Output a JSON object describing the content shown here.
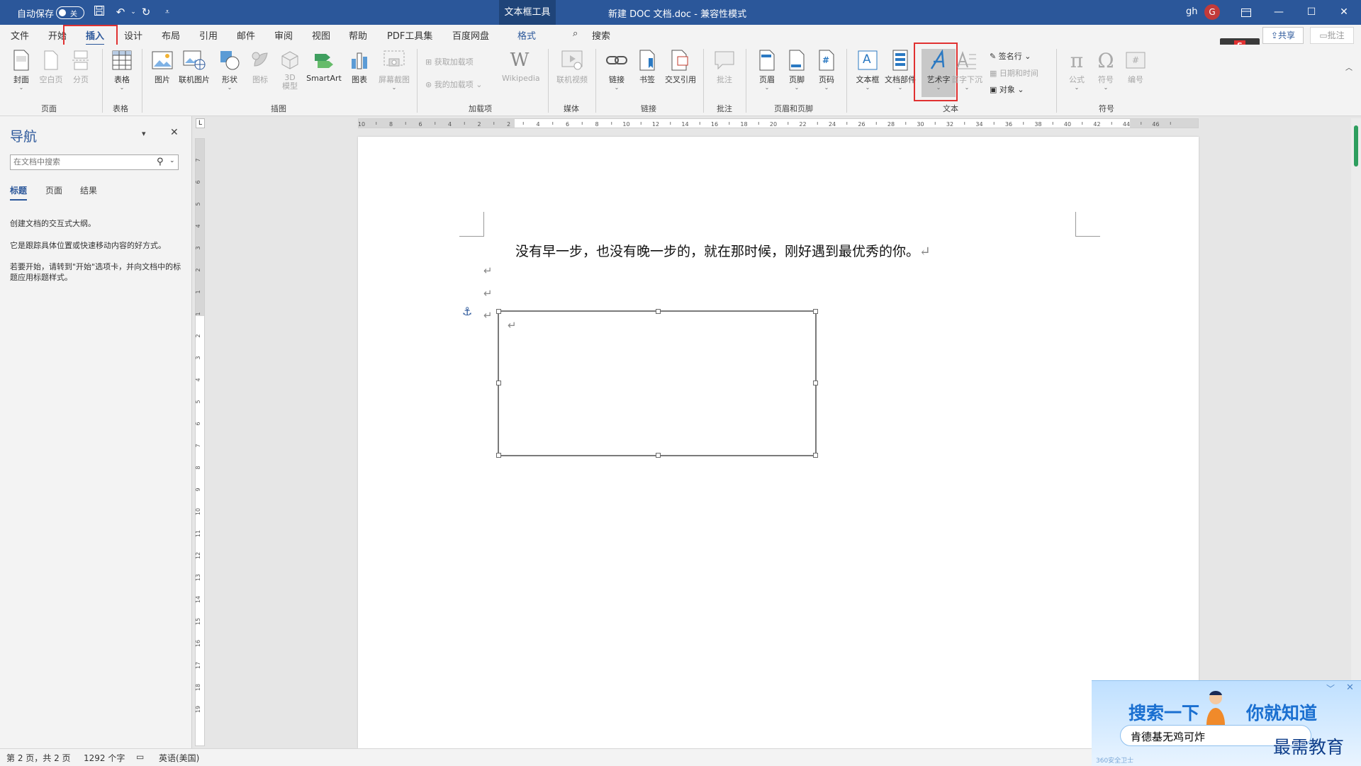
{
  "titlebar": {
    "autosave_label": "自动保存",
    "autosave_state": "关",
    "context_tab": "文本框工具",
    "doc_title": "新建 DOC 文档.doc",
    "separator": "-",
    "mode": "兼容性模式",
    "user": "gh",
    "avatar_initial": "G"
  },
  "tabs": [
    "文件",
    "开始",
    "插入",
    "设计",
    "布局",
    "引用",
    "邮件",
    "审阅",
    "视图",
    "帮助",
    "PDF工具集",
    "百度网盘",
    "格式"
  ],
  "tell_me": "搜索",
  "share_label": "共享",
  "comment_label": "批注",
  "ribbon": {
    "pages": [
      "封面",
      "空白页",
      "分页"
    ],
    "table": "表格",
    "illustrations": [
      "图片",
      "联机图片",
      "形状",
      "图标",
      "3D\n模型",
      "SmartArt",
      "图表",
      "屏幕截图"
    ],
    "addins": [
      "获取加载项",
      "我的加载项",
      "Wikipedia"
    ],
    "media": "联机视频",
    "links": [
      "链接",
      "书签",
      "交叉引用"
    ],
    "comments": "批注",
    "header_footer": [
      "页眉",
      "页脚",
      "页码"
    ],
    "text": [
      "文本框",
      "文档部件",
      "艺术字",
      "首字下沉"
    ],
    "text_small": [
      "签名行",
      "日期和时间",
      "对象"
    ],
    "symbols": [
      "公式",
      "符号",
      "编号"
    ],
    "groups": [
      "页面",
      "表格",
      "插图",
      "加载项",
      "媒体",
      "链接",
      "批注",
      "页眉和页脚",
      "文本",
      "符号"
    ]
  },
  "icons": {
    "wikipedia": "W",
    "equation": "π",
    "symbol": "Ω",
    "page_number": "#",
    "text_box": "A",
    "smartart": "▶"
  },
  "nav": {
    "title": "导航",
    "search_placeholder": "在文档中搜索",
    "tabs": [
      "标题",
      "页面",
      "结果"
    ],
    "paragraphs": [
      "创建文档的交互式大纲。",
      "它是跟踪具体位置或快速移动内容的好方式。",
      "若要开始，请转到\"开始\"选项卡，并向文档中的标题应用标题样式。"
    ]
  },
  "ruler": {
    "h_ticks": [
      "10",
      "8",
      "6",
      "4",
      "2",
      "2",
      "4",
      "6",
      "8",
      "10",
      "12",
      "14",
      "16",
      "18",
      "20",
      "22",
      "24",
      "26",
      "28",
      "30",
      "32",
      "34",
      "36",
      "38",
      "40",
      "42",
      "44",
      "46"
    ],
    "v_ticks": [
      "7",
      "6",
      "5",
      "4",
      "3",
      "2",
      "1",
      "1",
      "2",
      "3",
      "4",
      "5",
      "6",
      "7",
      "8",
      "9",
      "10",
      "11",
      "12",
      "13",
      "14",
      "15",
      "16",
      "17",
      "18",
      "19"
    ],
    "corner": "L"
  },
  "document": {
    "line1": "没有早一步，也没有晚一步的，就在那时候，刚好遇到最优秀的你。",
    "para_mark": "↵",
    "anchor": "⚓"
  },
  "status": {
    "page": "第 2 页，共 2 页",
    "words": "1292 个字",
    "lang": "英语(美国)"
  },
  "ad": {
    "title_a": "搜索一下",
    "title_b": "你就知道",
    "query": "肯德基无鸡可炸",
    "brand": "最需教育",
    "footer": "360安全卫士",
    "close": "✕",
    "minimize": "﹀"
  },
  "colors": {
    "brand": "#2b579a",
    "highlight_box": "#e03131"
  }
}
